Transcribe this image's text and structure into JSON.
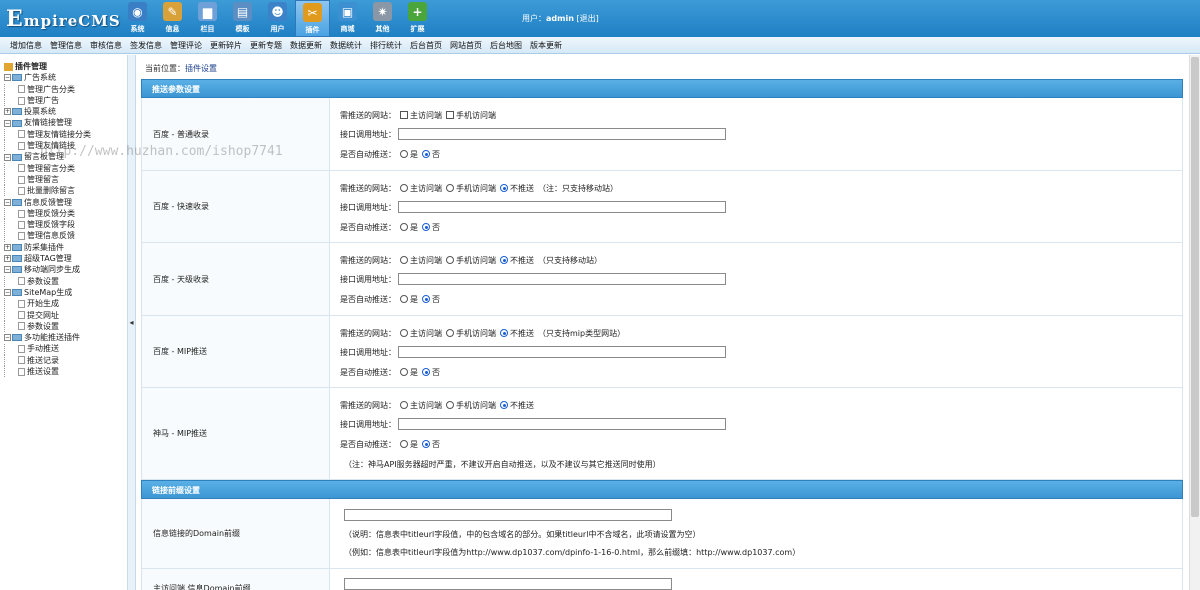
{
  "logo": {
    "first": "E",
    "rest": "mpireCMS"
  },
  "nav": [
    {
      "label": "系统",
      "icon": "globe-icon",
      "color": "#3a7fc6",
      "glyph": "◉"
    },
    {
      "label": "信息",
      "icon": "edit-icon",
      "color": "#d8a13a",
      "glyph": "✎"
    },
    {
      "label": "栏目",
      "icon": "folder-icon",
      "color": "#6fa0d8",
      "glyph": "▆"
    },
    {
      "label": "模板",
      "icon": "template-icon",
      "color": "#5b8ec2",
      "glyph": "▤"
    },
    {
      "label": "用户",
      "icon": "user-icon",
      "color": "#3b82c9",
      "glyph": "☻"
    },
    {
      "label": "插件",
      "icon": "plugin-icon",
      "color": "#e09a1e",
      "glyph": "✂"
    },
    {
      "label": "商城",
      "icon": "shop-icon",
      "color": "#3c8fd0",
      "glyph": "▣"
    },
    {
      "label": "其他",
      "icon": "gear-icon",
      "color": "#8a97a6",
      "glyph": "✷"
    },
    {
      "label": "扩展",
      "icon": "plus-icon",
      "color": "#4aa53a",
      "glyph": "+"
    }
  ],
  "user": {
    "prefix": "用户：",
    "name": "admin",
    "logout": "[退出]"
  },
  "subnav": [
    "增加信息",
    "管理信息",
    "审核信息",
    "签发信息",
    "管理评论",
    "更新碎片",
    "更新专题",
    "数据更新",
    "数据统计",
    "排行统计",
    "后台首页",
    "网站首页",
    "后台地图",
    "版本更新"
  ],
  "sidebar": {
    "root": "插件管理",
    "nodes": [
      {
        "label": "广告系统",
        "level": 0,
        "type": "folder-open"
      },
      {
        "label": "管理广告分类",
        "level": 1,
        "type": "leaf"
      },
      {
        "label": "管理广告",
        "level": 1,
        "type": "leaf"
      },
      {
        "label": "投票系统",
        "level": 0,
        "type": "folder-closed"
      },
      {
        "label": "友情链接管理",
        "level": 0,
        "type": "folder-open"
      },
      {
        "label": "管理友情链接分类",
        "level": 1,
        "type": "leaf"
      },
      {
        "label": "管理友情链接",
        "level": 1,
        "type": "leaf"
      },
      {
        "label": "留言板管理",
        "level": 0,
        "type": "folder-open"
      },
      {
        "label": "管理留言分类",
        "level": 1,
        "type": "leaf"
      },
      {
        "label": "管理留言",
        "level": 1,
        "type": "leaf"
      },
      {
        "label": "批量删除留言",
        "level": 1,
        "type": "leaf"
      },
      {
        "label": "信息反馈管理",
        "level": 0,
        "type": "folder-open"
      },
      {
        "label": "管理反馈分类",
        "level": 1,
        "type": "leaf"
      },
      {
        "label": "管理反馈字段",
        "level": 1,
        "type": "leaf"
      },
      {
        "label": "管理信息反馈",
        "level": 1,
        "type": "leaf"
      },
      {
        "label": "防采集插件",
        "level": 0,
        "type": "folder-closed"
      },
      {
        "label": "超级TAG管理",
        "level": 0,
        "type": "folder-closed"
      },
      {
        "label": "移动端同步生成",
        "level": 0,
        "type": "folder-open"
      },
      {
        "label": "参数设置",
        "level": 1,
        "type": "leaf"
      },
      {
        "label": "SiteMap生成",
        "level": 0,
        "type": "folder-open"
      },
      {
        "label": "开始生成",
        "level": 1,
        "type": "leaf"
      },
      {
        "label": "提交网址",
        "level": 1,
        "type": "leaf"
      },
      {
        "label": "参数设置",
        "level": 1,
        "type": "leaf"
      },
      {
        "label": "多功能推送插件",
        "level": 0,
        "type": "folder-open"
      },
      {
        "label": "手动推送",
        "level": 1,
        "type": "leaf"
      },
      {
        "label": "推送记录",
        "level": 1,
        "type": "leaf"
      },
      {
        "label": "推送设置",
        "level": 1,
        "type": "leaf"
      }
    ]
  },
  "breadcrumb": {
    "prefix": "当前位置：",
    "link": "插件设置"
  },
  "section1": "推送参数设置",
  "labels": {
    "site": "需推送的网站：",
    "api": "接口调用地址：",
    "auto": "是否自动推送：",
    "main_site": "主访问端",
    "mobile_site": "手机访问端",
    "no_push": "不推送",
    "yes": "是",
    "no": "否"
  },
  "push_rows": [
    {
      "name": "百度 - 普通收录",
      "mode": "checkbox",
      "note": "",
      "footnote": ""
    },
    {
      "name": "百度 - 快速收录",
      "mode": "radio",
      "note": "（注：只支持移动站）",
      "footnote": ""
    },
    {
      "name": "百度 - 天级收录",
      "mode": "radio",
      "note": "（只支持移动站）",
      "footnote": ""
    },
    {
      "name": "百度 - MIP推送",
      "mode": "radio",
      "note": "（只支持mip类型网站）",
      "footnote": ""
    },
    {
      "name": "神马 - MIP推送",
      "mode": "radio",
      "note": "",
      "footnote": "（注：神马API服务器超时严重，不建议开启自动推送，以及不建议与其它推送同时使用）"
    }
  ],
  "section2": "链接前缀设置",
  "prefix_rows": [
    {
      "name": "信息链接的Domain前缀",
      "desc1": "（说明：信息表中titleurl字段值，中的包含域名的部分。如果titleurl中不含域名，此项请设置为空）",
      "desc2": "（例如：信息表中titleurl字段值为http://www.dp1037.com/dpinfo-1-16-0.html，那么前缀填：http://www.dp1037.com）"
    },
    {
      "name": "主访问端 信息Domain前缀",
      "desc1": "",
      "desc2": ""
    }
  ],
  "watermark": "http://www.huzhan.com/ishop7741"
}
